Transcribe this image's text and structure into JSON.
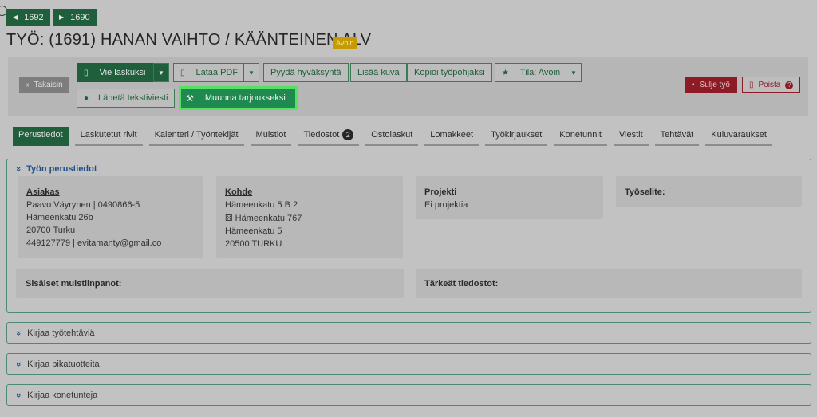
{
  "nav": {
    "prev_label": "1692",
    "next_label": "1690"
  },
  "header": {
    "title": "TYÖ: (1691) HANAN VAIHTO / KÄÄNTEINEN ALV",
    "status_badge": "Avoin"
  },
  "toolbar": {
    "back_label": "Takaisin",
    "export_invoice_label": "Vie laskuksi",
    "download_pdf_label": "Lataa PDF",
    "request_approval_label": "Pyydä hyväksyntä",
    "add_image_label": "Lisää kuva",
    "copy_template_label": "Kopioi työpohjaksi",
    "status_label": "Tila: Avoin",
    "send_sms_label": "Lähetä tekstiviesti",
    "convert_offer_label": "Muunna tarjoukseksi",
    "close_job_label": "Sulje työ",
    "delete_label": "Poista"
  },
  "tabs": [
    {
      "label": "Perustiedot"
    },
    {
      "label": "Laskutetut rivit"
    },
    {
      "label": "Kalenteri / Työntekijät"
    },
    {
      "label": "Muistiot"
    },
    {
      "label": "Tiedostot",
      "count": "2"
    },
    {
      "label": "Ostolaskut"
    },
    {
      "label": "Lomakkeet"
    },
    {
      "label": "Työkirjaukset"
    },
    {
      "label": "Konetunnit"
    },
    {
      "label": "Viestit"
    },
    {
      "label": "Tehtävät"
    },
    {
      "label": "Kuluvaraukset"
    }
  ],
  "basic_info": {
    "title": "Työn perustiedot",
    "customer": {
      "heading": "Asiakas",
      "lines": [
        "Paavo Väyrynen | 0490866-5",
        "Hämeenkatu 26b",
        "20700 Turku",
        "449127779 | evitamanty@gmail.co"
      ]
    },
    "target": {
      "heading": "Kohde",
      "lines": [
        "Hämeenkatu 5 B 2",
        "Hämeenkatu 767",
        "Hämeenkatu 5",
        "20500 TURKU"
      ]
    },
    "project": {
      "heading": "Projekti",
      "value": "Ei projektia"
    },
    "description": {
      "heading": "Työselite:"
    },
    "internal_notes": {
      "heading": "Sisäiset muistiinpanot:"
    },
    "important_files": {
      "heading": "Tärkeät tiedostot:"
    }
  },
  "collapsed_sections": [
    {
      "label": "Kirjaa työtehtäviä"
    },
    {
      "label": "Kirjaa pikatuotteita"
    },
    {
      "label": "Kirjaa konetunteja"
    }
  ],
  "colors": {
    "primary_green": "#1f5f3b",
    "highlight": "#56e064",
    "danger": "#8c1b25",
    "badge": "#c69a00",
    "link_blue": "#1f4f8a"
  }
}
